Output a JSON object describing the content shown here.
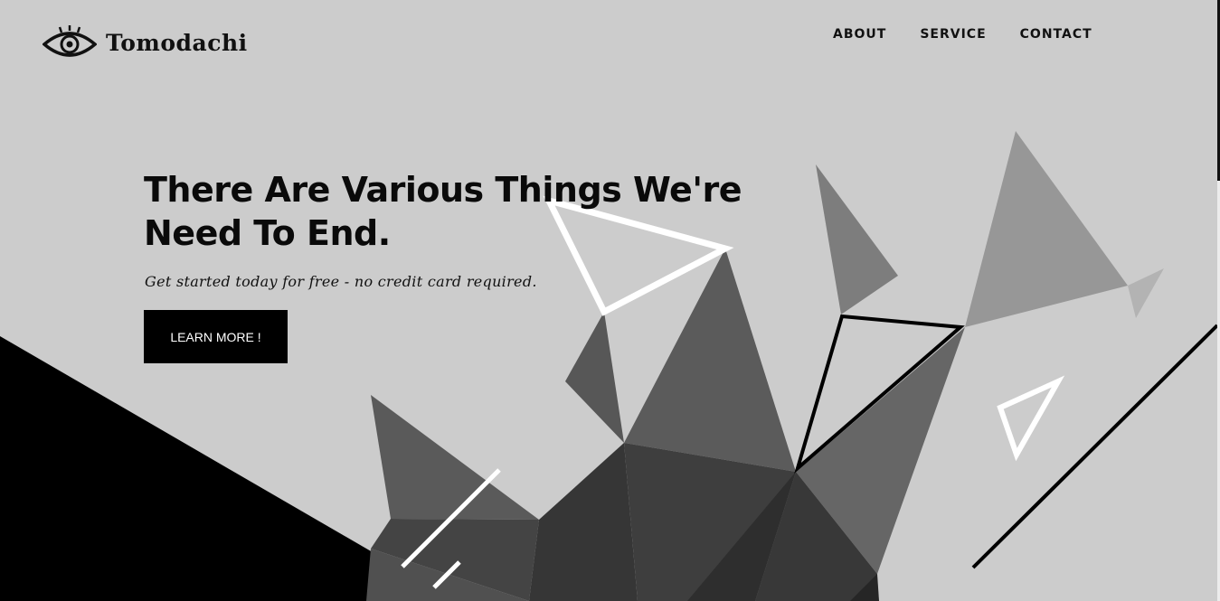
{
  "brand": {
    "name": "Tomodachi",
    "logo_icon": "eye-icon"
  },
  "nav": {
    "items": [
      {
        "label": "ABOUT"
      },
      {
        "label": "SERVICE"
      },
      {
        "label": "CONTACT"
      }
    ]
  },
  "hero": {
    "title_line1": "There Are Various Things We're",
    "title_line2": "Need To End.",
    "subtitle": "Get started today for free - no credit card required.",
    "cta_label": "LEARN MORE !"
  },
  "colors": {
    "background": "#cccccc",
    "text": "#111111",
    "button_bg": "#000000",
    "button_text": "#ffffff"
  }
}
